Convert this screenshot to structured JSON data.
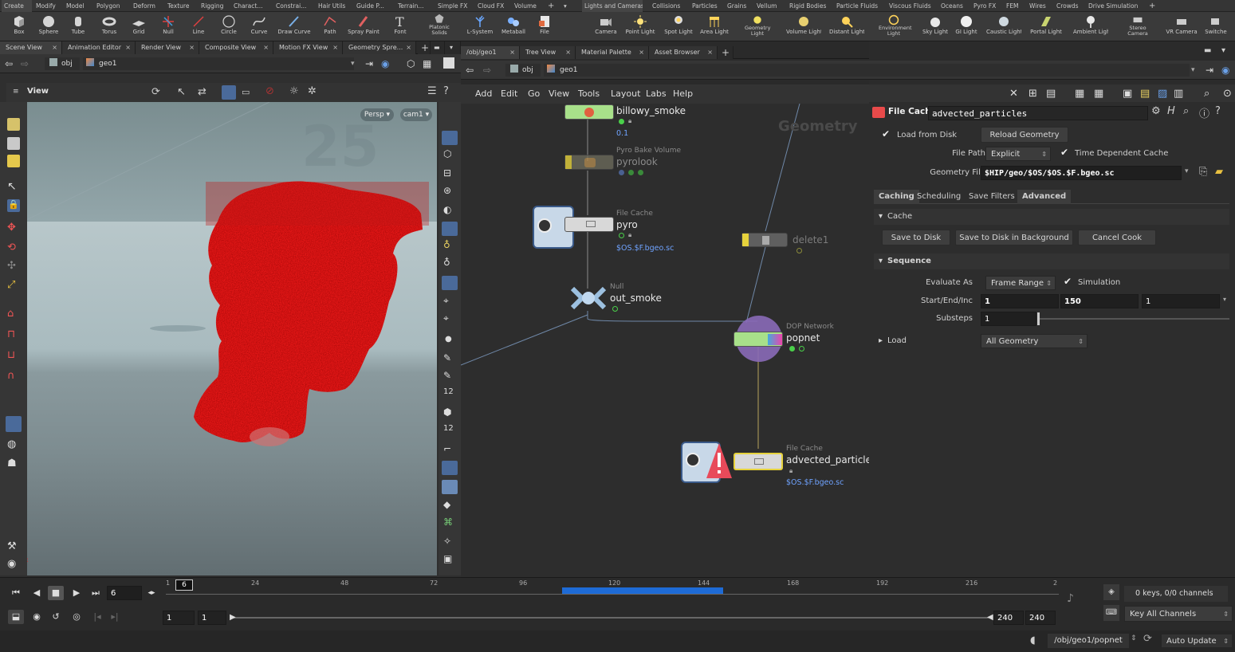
{
  "shelf_tabs": {
    "left": [
      "Create",
      "Modify",
      "Model",
      "Polygon",
      "Deform",
      "Texture",
      "Rigging",
      "Charact...",
      "Constrai...",
      "Hair Utils",
      "Guide P...",
      "Terrain...",
      "Simple FX",
      "Cloud FX",
      "Volume"
    ],
    "right": [
      "Lights and Cameras",
      "Collisions",
      "Particles",
      "Grains",
      "Vellum",
      "Rigid Bodies",
      "Particle Fluids",
      "Viscous Fluids",
      "Oceans",
      "Pyro FX",
      "FEM",
      "Wires",
      "Crowds",
      "Drive Simulation"
    ]
  },
  "shelf_tools": {
    "left": [
      "Box",
      "Sphere",
      "Tube",
      "Torus",
      "Grid",
      "Null",
      "Line",
      "Circle",
      "Curve",
      "Draw Curve",
      "Path",
      "Spray Paint",
      "Font",
      "Platonic Solids",
      "L-System",
      "Metaball",
      "File"
    ],
    "right": [
      "Camera",
      "Point Light",
      "Spot Light",
      "Area Light",
      "Geometry Light",
      "Volume Light",
      "Distant Light",
      "Environment Light",
      "Sky Light",
      "GI Light",
      "Caustic Light",
      "Portal Light",
      "Ambient Light",
      "Stereo Camera",
      "VR Camera",
      "Switche"
    ]
  },
  "left_pane": {
    "tabs": [
      "Scene View",
      "Animation Editor",
      "Render View",
      "Composite View",
      "Motion FX View",
      "Geometry Spre..."
    ],
    "path": [
      "obj",
      "geo1"
    ],
    "view_label": "View",
    "persp": "Persp",
    "cam": "cam1"
  },
  "net_pane": {
    "tabs": [
      "/obj/geo1",
      "Tree View",
      "Material Palette",
      "Asset Browser"
    ],
    "path": [
      "obj",
      "geo1"
    ],
    "menu": [
      "Add",
      "Edit",
      "Go",
      "View",
      "Tools",
      "Layout",
      "Labs",
      "Help"
    ],
    "context_label": "Geometry",
    "nodes": {
      "billowy": {
        "name": "billowy_smoke",
        "value": "0.1"
      },
      "pyrolook": {
        "type": "Pyro Bake Volume",
        "name": "pyrolook"
      },
      "pyro": {
        "type": "File Cache",
        "name": "pyro",
        "file": "$OS.$F.bgeo.sc"
      },
      "out_smoke": {
        "type": "Null",
        "name": "out_smoke"
      },
      "delete1": {
        "name": "delete1"
      },
      "popnet": {
        "type": "DOP Network",
        "name": "popnet"
      },
      "advected": {
        "type": "File Cache",
        "name": "advected_particle",
        "file": "$OS.$F.bgeo.sc"
      }
    }
  },
  "parm_pane": {
    "node_type": "File Cache",
    "node_name": "advected_particles",
    "load_from_disk": "Load from Disk",
    "reload": "Reload Geometry",
    "file_path_label": "File Path",
    "file_path_value": "Explicit",
    "time_dependent": "Time Dependent Cache",
    "geometry_file_label": "Geometry File",
    "geometry_file": "$HIP/geo/$OS/$OS.$F.bgeo.sc",
    "tabs": [
      "Caching",
      "Scheduling",
      "Save Filters",
      "Advanced"
    ],
    "cache_section": "Cache",
    "save_to_disk": "Save to Disk",
    "save_bg": "Save to Disk in Background",
    "cancel": "Cancel Cook",
    "sequence_section": "Sequence",
    "evaluate_as_label": "Evaluate As",
    "evaluate_as": "Frame Range",
    "simulation": "Simulation",
    "start_end_label": "Start/End/Inc",
    "start": "1",
    "end": "150",
    "inc": "1",
    "substeps_label": "Substeps",
    "substeps": "1",
    "load_section": "Load",
    "load_value": "All Geometry"
  },
  "timeline": {
    "current_frame": "6",
    "frame_field": "6",
    "ticks": [
      "1",
      "24",
      "48",
      "72",
      "96",
      "120",
      "144",
      "168",
      "192",
      "216",
      "2"
    ],
    "range_start": "1",
    "range_start2": "1",
    "range_end": "240",
    "range_end2": "240",
    "keys_label": "0 keys, 0/0 channels",
    "key_all": "Key All Channels",
    "status_path": "/obj/geo1/popnet",
    "auto_update": "Auto Update"
  },
  "colors": {
    "accent_blue": "#1e6bd6",
    "smoke_red": "#ff2020",
    "node_green": "#a8e08a",
    "node_yellow": "#e6d23c"
  }
}
